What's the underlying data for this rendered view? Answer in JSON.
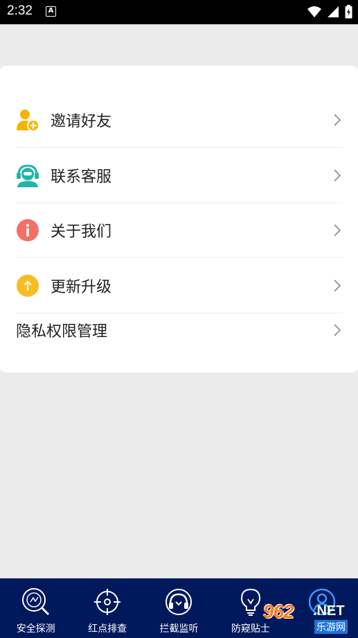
{
  "status": {
    "time": "2:32",
    "indicator": "A"
  },
  "menu": {
    "items": [
      {
        "label": "邀请好友",
        "icon": "add-user-icon"
      },
      {
        "label": "联系客服",
        "icon": "customer-service-icon"
      },
      {
        "label": "关于我们",
        "icon": "info-icon"
      },
      {
        "label": "更新升级",
        "icon": "upgrade-arrow-icon"
      },
      {
        "label": "隐私权限管理",
        "icon": ""
      }
    ]
  },
  "tabbar": {
    "tabs": [
      {
        "label": "安全探测",
        "icon": "detect-icon"
      },
      {
        "label": "红点排查",
        "icon": "target-icon"
      },
      {
        "label": "拦截监听",
        "icon": "intercept-icon"
      },
      {
        "label": "防窥贴士",
        "icon": "bulb-icon"
      },
      {
        "label": "",
        "icon": "profile-icon"
      }
    ]
  },
  "watermark": {
    "brand": "962",
    "net": ".NET",
    "sub": "乐游网"
  },
  "colors": {
    "tabbar": "#00185c",
    "user_icon": "#f5b400",
    "service_icon": "#22b4a8",
    "info_icon": "#f27067",
    "upgrade_icon": "#f8bd24"
  }
}
